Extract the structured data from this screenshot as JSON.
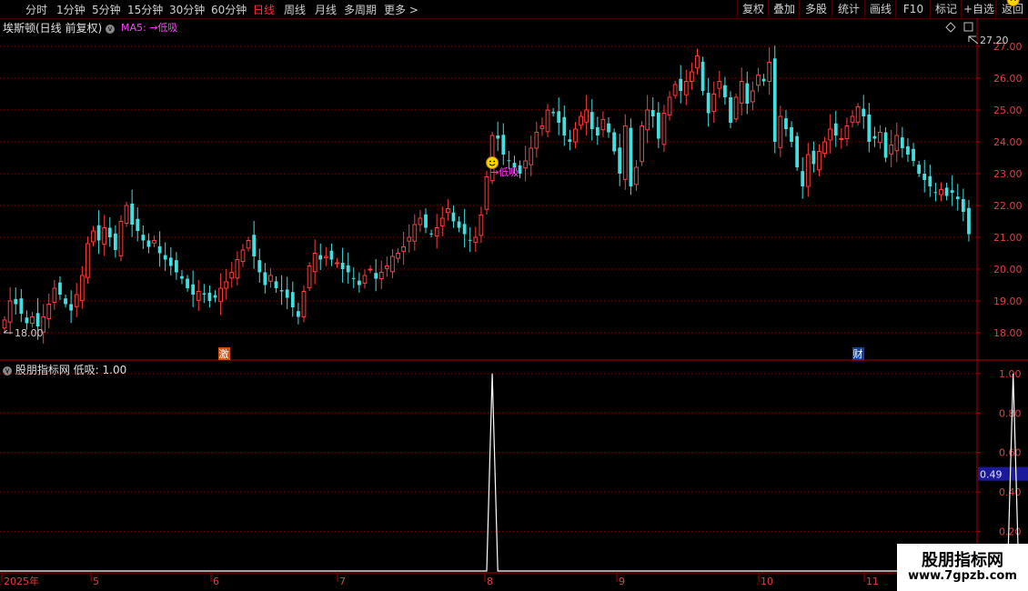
{
  "toolbar": {
    "left": [
      "分时",
      "1分钟",
      "5分钟",
      "15分钟",
      "30分钟",
      "60分钟",
      "日线",
      "周线",
      "月线",
      "多周期",
      "更多 >"
    ],
    "active": "日线",
    "right": [
      "复权",
      "叠加",
      "多股",
      "统计",
      "画线",
      "F10",
      "标记",
      "+自选",
      "返回"
    ]
  },
  "main": {
    "title": "埃斯顿(日线 前复权)",
    "ma_label": "MA5: →低吸"
  },
  "sub": {
    "title": "股朋指标网 低吸: 1.00"
  },
  "watermark": {
    "line1": "股朋指标网",
    "line2": "www.7gpzb.com"
  },
  "markers": {
    "ji": "激",
    "cai": "财"
  },
  "colors": {
    "up": "#ff3c3c",
    "down": "#40e0e0",
    "grid": "#8a0000",
    "axis": "#b00000",
    "signal": "#ff40ff"
  },
  "chart_data": [
    {
      "type": "candlestick",
      "title": "埃斯顿(日线 前复权)",
      "ylim": [
        17.6,
        27.6
      ],
      "yticks": [
        "18.00",
        "19.00",
        "20.00",
        "21.00",
        "22.00",
        "23.00",
        "24.00",
        "25.00",
        "26.00",
        "27.00"
      ],
      "high_label": "27.20",
      "low_label": "18.00",
      "close": [
        18.4,
        19.0,
        18.9,
        18.6,
        18.3,
        18.5,
        18.2,
        18.5,
        18.9,
        19.4,
        19.2,
        18.9,
        18.7,
        19.2,
        19.8,
        20.8,
        21.2,
        20.9,
        21.3,
        21.0,
        20.6,
        21.5,
        22.0,
        21.4,
        21.2,
        20.9,
        20.7,
        20.9,
        20.5,
        20.3,
        20.1,
        19.9,
        19.7,
        19.4,
        19.2,
        19.3,
        19.2,
        19.0,
        19.1,
        19.4,
        19.6,
        19.9,
        20.3,
        20.6,
        20.9,
        20.4,
        19.9,
        19.5,
        19.8,
        19.4,
        19.3,
        19.1,
        18.8,
        18.5,
        19.3,
        20.1,
        20.5,
        20.3,
        20.4,
        20.3,
        20.2,
        20.0,
        19.9,
        19.7,
        19.5,
        19.8,
        20.0,
        19.7,
        19.9,
        20.1,
        20.4,
        20.5,
        20.7,
        21.0,
        21.4,
        21.6,
        21.3,
        21.1,
        21.3,
        21.6,
        21.9,
        21.5,
        21.3,
        21.1,
        20.9,
        21.0,
        21.7,
        22.9,
        24.2,
        24.1,
        23.6,
        23.4,
        23.2,
        23.0,
        23.4,
        23.8,
        24.3,
        24.5,
        25.0,
        24.9,
        24.6,
        24.2,
        24.0,
        24.4,
        24.8,
        25.0,
        24.4,
        24.2,
        24.7,
        24.3,
        23.7,
        23.0,
        24.5,
        22.6,
        23.2,
        24.5,
        25.0,
        24.8,
        24.1,
        24.9,
        25.4,
        25.8,
        25.6,
        25.9,
        26.2,
        26.7,
        25.6,
        24.9,
        25.5,
        25.9,
        25.4,
        24.6,
        25.4,
        25.9,
        25.2,
        25.6,
        26.1,
        25.9,
        26.5,
        24.0,
        24.8,
        24.4,
        24.0,
        23.2,
        22.6,
        23.6,
        23.3,
        23.7,
        24.0,
        24.4,
        24.2,
        24.1,
        24.5,
        24.8,
        25.1,
        24.8,
        24.0,
        24.1,
        24.3,
        23.5,
        23.9,
        24.2,
        23.8,
        23.6,
        23.4,
        23.0,
        22.8,
        22.6,
        22.4,
        22.5,
        22.3,
        22.4,
        22.2,
        21.8,
        21.1
      ],
      "x_labels": [
        "2025年",
        "5",
        "6",
        "7",
        "8",
        "9",
        "10",
        "11"
      ],
      "signals": [
        {
          "label": "→低吸",
          "index": 88
        },
        {
          "label": "→低吸",
          "index": 182
        }
      ]
    },
    {
      "type": "line",
      "title": "股朋指标网 低吸",
      "ylim": [
        0,
        1.05
      ],
      "yticks": [
        "1.00",
        "0.80",
        "0.60",
        "0.40",
        "0.20"
      ],
      "current": "0.49",
      "series": [
        {
          "name": "低吸",
          "pulses": [
            {
              "index": 88,
              "value": 1.0
            },
            {
              "index": 182,
              "value": 1.0
            }
          ]
        }
      ]
    }
  ]
}
